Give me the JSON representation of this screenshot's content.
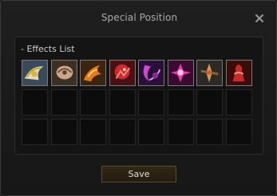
{
  "window": {
    "title": "Special Position",
    "close_icon": "close-icon"
  },
  "effects": {
    "label": "- Effects List",
    "slots_total": 24,
    "icons": [
      {
        "name": "winged-crest-icon",
        "accent": "#d7b94b"
      },
      {
        "name": "shell-helm-icon",
        "accent": "#b28a6b"
      },
      {
        "name": "fire-wing-icon",
        "accent": "#d06a1e"
      },
      {
        "name": "crimson-beast-icon",
        "accent": "#d8323a"
      },
      {
        "name": "violet-crescent-icon",
        "accent": "#b23ab8"
      },
      {
        "name": "magenta-burst-icon",
        "accent": "#e03aa0"
      },
      {
        "name": "ornate-cross-icon",
        "accent": "#c8a040"
      },
      {
        "name": "red-figure-icon",
        "accent": "#c02a2a"
      }
    ]
  },
  "footer": {
    "save_label": "Save"
  },
  "colors": {
    "window_bg": "#1b1b1b",
    "panel_bg": "#141414",
    "button_border": "#5e4b2c"
  }
}
